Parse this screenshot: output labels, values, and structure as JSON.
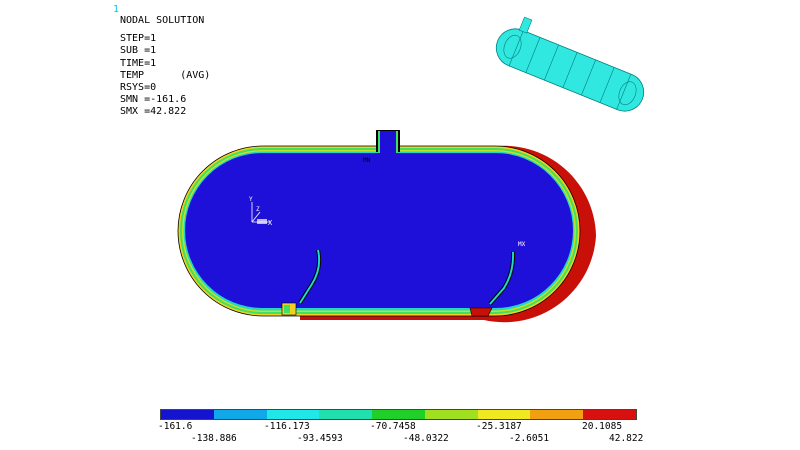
{
  "window_number": "1",
  "info": {
    "title": "NODAL SOLUTION",
    "step": "STEP=1",
    "sub": "SUB =1",
    "time": "TIME=1",
    "result": "TEMP      (AVG)",
    "rsys": "RSYS=0",
    "smn": "SMN =-161.6",
    "smx": "SMX =42.822"
  },
  "markers": {
    "mn": "MN",
    "mx": "MX",
    "triad_y": "Y",
    "triad_z": "Z",
    "triad_x": "X"
  },
  "colors": {
    "vessel_body": "#1e10d8",
    "vessel_shadow": "#c81008",
    "shell_outer": "#f0d020",
    "shell_mid": "#40e060",
    "preview_fill": "#30e8e0",
    "preview_edge": "#008080"
  },
  "legend": {
    "colors": [
      "#1414d0",
      "#10a8e8",
      "#20e8e8",
      "#20e0b0",
      "#20d028",
      "#a0e020",
      "#f0e820",
      "#f0a010",
      "#d81010"
    ],
    "labels_bottom": [
      "-161.6",
      "-116.173",
      "-70.7458",
      "-25.3187",
      "20.1085"
    ],
    "labels_top": [
      "-138.886",
      "-93.4593",
      "-48.0322",
      "-2.6051",
      "42.822"
    ]
  }
}
